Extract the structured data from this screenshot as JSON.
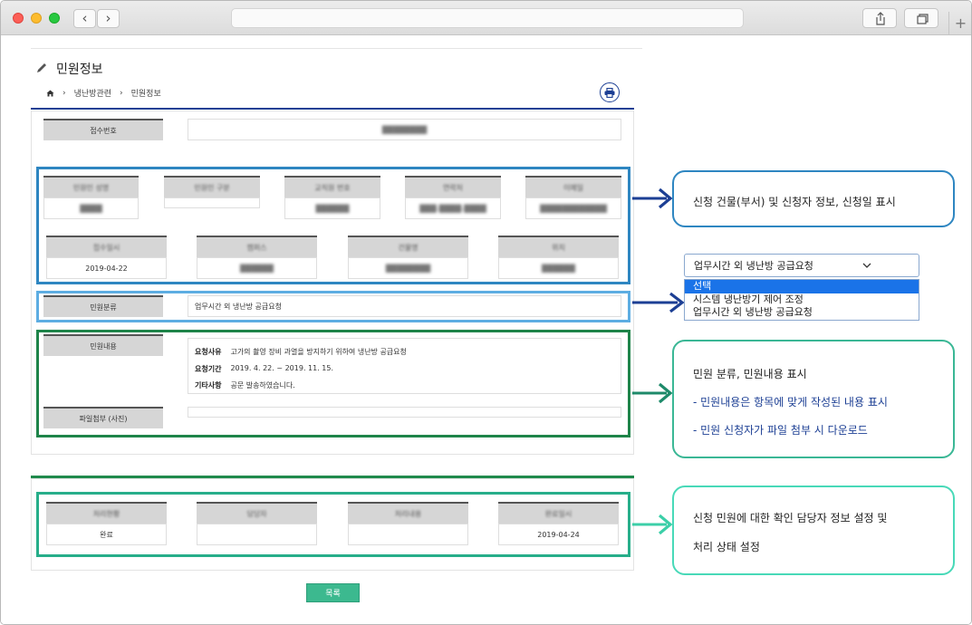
{
  "browser": {
    "back_glyph": "‹",
    "forward_glyph": "›",
    "new_tab_glyph": "+"
  },
  "page": {
    "title": "민원정보",
    "breadcrumb": {
      "home_icon": "home-icon",
      "separator": "›",
      "level1": "냉난방관련",
      "level2": "민원정보"
    },
    "print_icon": "printer-icon"
  },
  "receipt": {
    "label": "접수번호",
    "value": "████████"
  },
  "applicant": {
    "fields": [
      {
        "label": "민원인 성명",
        "value": "████"
      },
      {
        "label": "민원인 구분",
        "value": ""
      },
      {
        "label": "교직원 번호",
        "value": "██████"
      },
      {
        "label": "연락처",
        "value": "███-████-████"
      },
      {
        "label": "이메일",
        "value": "████████████"
      }
    ],
    "fields2": [
      {
        "label": "접수일시",
        "value": "2019-04-22"
      },
      {
        "label": "캠퍼스",
        "value": "██████"
      },
      {
        "label": "건물명",
        "value": "████████"
      },
      {
        "label": "위치",
        "value": "██████"
      }
    ]
  },
  "category": {
    "label": "민원분류",
    "value": "업무시간 외 냉난방 공급요청"
  },
  "content": {
    "label": "민원내용",
    "rows": [
      {
        "key": "요청사유",
        "value": "고가의 촬영 장비 과열을 방지하기 위하여 냉난방 공급요청"
      },
      {
        "key": "요청기간",
        "value": "2019. 4. 22. ~ 2019. 11. 15."
      },
      {
        "key": "기타사항",
        "value": "공문 발송하였습니다."
      }
    ],
    "attachment_label": "파일첨부 (사진)",
    "attachment_value": ""
  },
  "processing": {
    "fields": [
      {
        "label": "처리현황",
        "value": "완료"
      },
      {
        "label": "담당자",
        "value": ""
      },
      {
        "label": "처리내용",
        "value": ""
      },
      {
        "label": "완료일시",
        "value": "2019-04-24"
      }
    ]
  },
  "list_button": "목록",
  "callouts": {
    "c1": "신청 건물(부서) 및 신청자 정보, 신청일 표시",
    "c2_title": "민원 분류, 민원내용 표시",
    "c2_line1": "- 민원내용은 항목에 맞게 작성된 내용 표시",
    "c2_line2": "- 민원 신청자가 파일 첨부 시 다운로드",
    "c3_line1": "신청 민원에 대한 확인 담당자 정보 설정 및",
    "c3_line2": "처리 상태 설정"
  },
  "select": {
    "value": "업무시간 외 냉난방 공급요청",
    "options": [
      "선택",
      "시스템 냉난방기 제어 조정",
      "업무시간 외 냉난방 공급요청"
    ]
  },
  "colors": {
    "navy": "#1c3f94",
    "box_blue": "#2e86c1",
    "box_lightblue": "#5dade2",
    "box_green": "#1e8449",
    "box_teal": "#27ae8a",
    "button_green": "#3cb98f",
    "dropdown_selected": "#1a73e8"
  }
}
